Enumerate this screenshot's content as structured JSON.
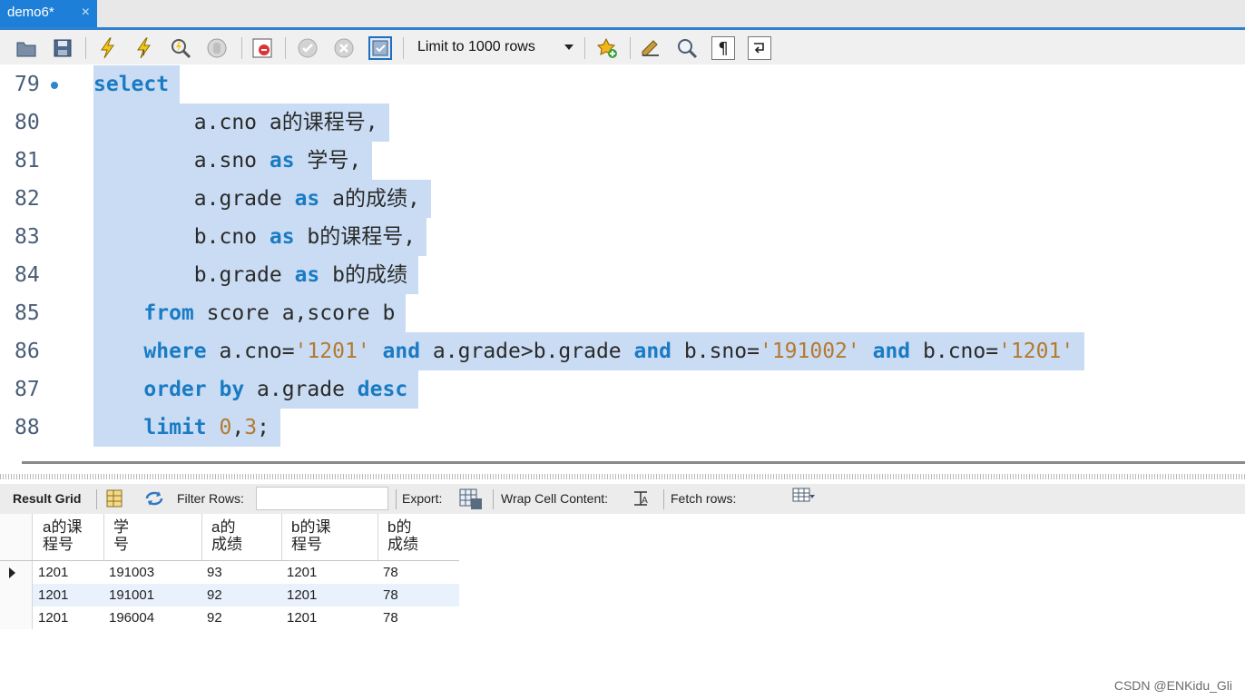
{
  "tab": {
    "title": "demo6*",
    "close": "×"
  },
  "toolbar": {
    "limit_label": "Limit to 1000 rows",
    "icons": [
      "open-folder-icon",
      "save-icon",
      "execute-icon",
      "execute-current-icon",
      "explain-icon",
      "stop-icon",
      "toggle-error-stop-icon",
      "commit-icon",
      "rollback-icon",
      "autocommit-icon",
      "add-snippet-icon",
      "beautify-icon",
      "find-icon",
      "invisible-chars-icon",
      "wrap-icon"
    ]
  },
  "editor": {
    "lines": [
      {
        "n": "79",
        "html": "<span class='kw'>select</span>"
      },
      {
        "n": "80",
        "html": "        a.cno a的课程号,"
      },
      {
        "n": "81",
        "html": "        a.sno <span class='kw'>as</span> 学号,"
      },
      {
        "n": "82",
        "html": "        a.grade <span class='kw'>as</span> a的成绩,"
      },
      {
        "n": "83",
        "html": "        b.cno <span class='kw'>as</span> b的课程号,"
      },
      {
        "n": "84",
        "html": "        b.grade <span class='kw'>as</span> b的成绩"
      },
      {
        "n": "85",
        "html": "    <span class='kw'>from</span> score a,score b"
      },
      {
        "n": "86",
        "html": "    <span class='kw'>where</span> a.cno=<span class='str'>'1201'</span> <span class='kw'>and</span> a.grade&gt;b.grade <span class='kw'>and</span> b.sno=<span class='str'>'191002'</span> <span class='kw'>and</span> b.cno=<span class='str'>'1201'</span>"
      },
      {
        "n": "87",
        "html": "    <span class='kw'>order by</span> a.grade <span class='kw'>desc</span>"
      },
      {
        "n": "88",
        "html": "    <span class='kw'>limit</span> <span class='num'>0</span>,<span class='num'>3</span>;"
      }
    ]
  },
  "results_toolbar": {
    "result_grid": "Result Grid",
    "filter_rows": "Filter Rows:",
    "filter_value": "",
    "export": "Export:",
    "wrap": "Wrap Cell Content:",
    "fetch": "Fetch rows:"
  },
  "grid": {
    "headers": [
      [
        "a的课",
        "程号"
      ],
      [
        "学",
        "号"
      ],
      [
        "a的",
        "成绩"
      ],
      [
        "b的课",
        "程号"
      ],
      [
        "b的",
        "成绩"
      ]
    ],
    "rows": [
      [
        "1201",
        "191003",
        "93",
        "1201",
        "78"
      ],
      [
        "1201",
        "191001",
        "92",
        "1201",
        "78"
      ],
      [
        "1201",
        "196004",
        "92",
        "1201",
        "78"
      ]
    ]
  },
  "watermark": "CSDN @ENKidu_Gli"
}
